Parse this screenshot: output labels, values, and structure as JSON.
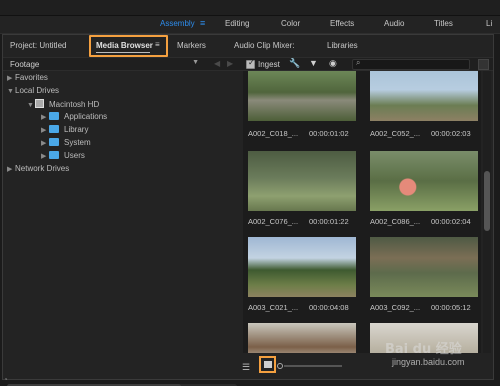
{
  "workspace_tabs": [
    {
      "label": "Assembly",
      "active": true
    },
    {
      "label": "Editing"
    },
    {
      "label": "Color"
    },
    {
      "label": "Effects"
    },
    {
      "label": "Audio"
    },
    {
      "label": "Titles"
    },
    {
      "label": "Li"
    }
  ],
  "panel_tabs": {
    "project": "Project: Untitled",
    "media_browser": "Media Browser",
    "markers": "Markers",
    "audio_clip_mixer": "Audio Clip Mixer:",
    "libraries": "Libraries"
  },
  "toolbar": {
    "footage_select": "Footage",
    "ingest_label": "Ingest",
    "ingest_checked": true,
    "icons": [
      "back-arrow-icon",
      "forward-arrow-icon",
      "wrench-icon",
      "filter-icon",
      "eye-icon",
      "search-icon"
    ]
  },
  "tree": {
    "favorites": "Favorites",
    "local_drives": "Local Drives",
    "macintosh_hd": "Macintosh HD",
    "folders": [
      "Applications",
      "Library",
      "System",
      "Users"
    ],
    "network_drives": "Network Drives"
  },
  "clips": [
    {
      "name": "A002_C018_...",
      "duration": "00:00:01:02"
    },
    {
      "name": "A002_C052_...",
      "duration": "00:00:02:03"
    },
    {
      "name": "A002_C076_...",
      "duration": "00:00:01:22"
    },
    {
      "name": "A002_C086_...",
      "duration": "00:00:02:04"
    },
    {
      "name": "A003_C021_...",
      "duration": "00:00:04:08"
    },
    {
      "name": "A003_C092_...",
      "duration": "00:00:05:12"
    }
  ],
  "watermark": {
    "brand": "Bai du 经验",
    "url": "jingyan.baidu.com"
  },
  "colors": {
    "accent": "#2d8ceb",
    "highlight": "#f4a040",
    "folder": "#4aa8e8"
  }
}
